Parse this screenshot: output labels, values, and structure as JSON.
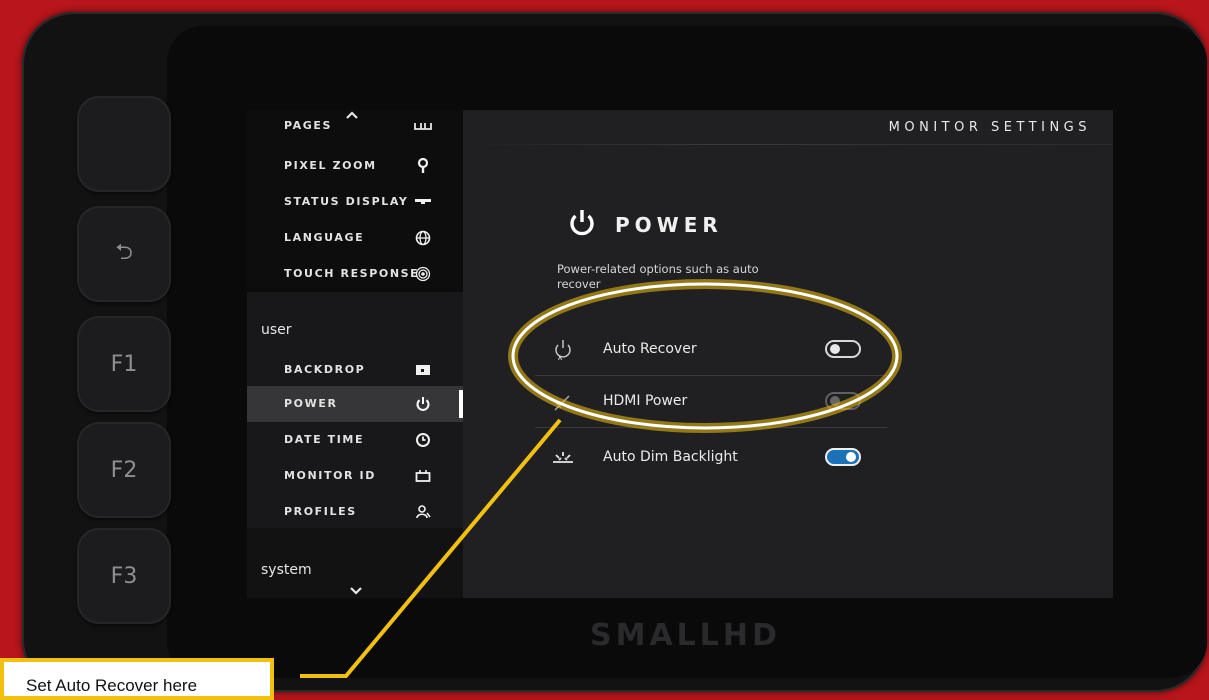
{
  "hardware": {
    "back_glyph": "⮌",
    "f1": "F1",
    "f2": "F2",
    "f3": "F3",
    "brand": "SMALLHD"
  },
  "sidebar": {
    "top_items": [
      {
        "label": "PAGES",
        "icon": "pages-icon"
      },
      {
        "label": "PIXEL ZOOM",
        "icon": "pin-icon"
      },
      {
        "label": "STATUS DISPLAY",
        "icon": "status-bar-icon"
      },
      {
        "label": "LANGUAGE",
        "icon": "globe-icon"
      },
      {
        "label": "TOUCH RESPONSE",
        "icon": "touch-icon"
      }
    ],
    "user_group": "user",
    "user_items": [
      {
        "label": "BACKDROP",
        "icon": "image-icon"
      },
      {
        "label": "POWER",
        "icon": "power-icon",
        "active": true
      },
      {
        "label": "DATE TIME",
        "icon": "clock-icon"
      },
      {
        "label": "MONITOR ID",
        "icon": "monitor-id-icon"
      },
      {
        "label": "PROFILES",
        "icon": "profile-icon"
      }
    ],
    "system_group": "system"
  },
  "main": {
    "breadcrumb": "MONITOR SETTINGS",
    "title": "POWER",
    "description": "Power-related options such as auto recover",
    "settings": [
      {
        "label": "Auto Recover",
        "icon": "auto-recover-icon",
        "enabled": false
      },
      {
        "label": "HDMI Power",
        "icon": "hdmi-power-icon",
        "enabled": false
      },
      {
        "label": "Auto Dim Backlight",
        "icon": "dim-backlight-icon",
        "enabled": true
      }
    ]
  },
  "annotation": {
    "callout_text": "Set Auto Recover here",
    "highlight_color": "#f2c10f"
  },
  "colors": {
    "case_red": "#b8161c",
    "toggle_on": "#1a73b8"
  }
}
